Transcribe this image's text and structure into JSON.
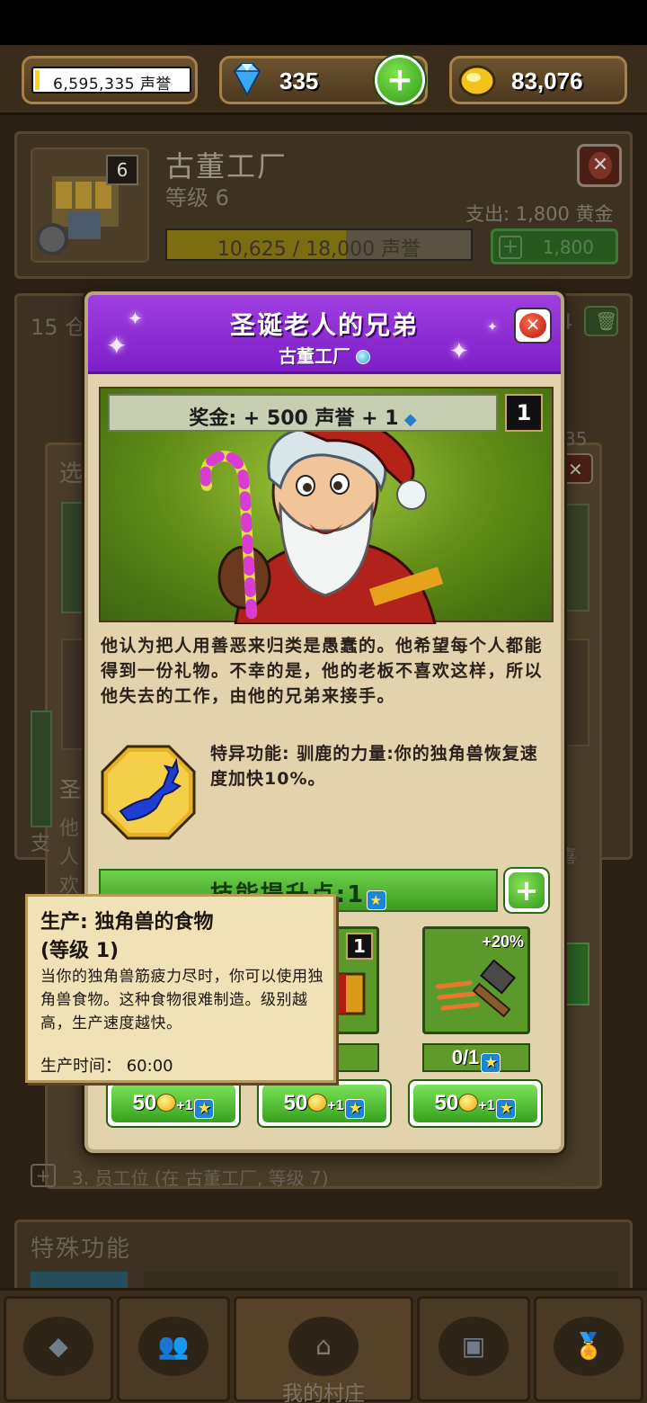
{
  "hud": {
    "reputation": "6,595,335 声誉",
    "gems": "335",
    "gold": "83,076"
  },
  "building": {
    "level_badge": "6",
    "name": "古董工厂",
    "level": "等级 6",
    "expense": "支出: 1,800 黄金",
    "progress_text": "10,625 / 18,000 声誉",
    "progress_fraction": 0.59,
    "upgrade_cost": "1,800"
  },
  "background": {
    "inventory_label": "15 仓",
    "inventory_right": "4",
    "sub_title": "选",
    "side_a": "圣",
    "side_b": "他人欢",
    "side_c": "支",
    "side_d": "喜",
    "num_35": "35",
    "worker_slot": "3. 员工位 (在 古董工厂, 等级 7)",
    "special_title": "特殊功能"
  },
  "nav": {
    "center_label": "我的村庄"
  },
  "modal": {
    "title": "圣诞老人的兄弟",
    "subtitle": "古董工厂",
    "bonus": "奖金: + 500 声誉 + 1",
    "count": "1",
    "description": "他认为把人用善恶来归类是愚蠢的。他希望每个人都能得到一份礼物。不幸的是，他的老板不喜欢这样，所以他失去的工作，由他的兄弟来接手。",
    "ability": "特异功能: 驯鹿的力量:你的独角兽恢复速度加快10%。",
    "skill_points": "技能提升点:1",
    "skills": [
      {
        "badge": "",
        "progress": ""
      },
      {
        "badge": "1",
        "progress": ""
      },
      {
        "badge": "+20%",
        "progress": "0/1"
      }
    ],
    "cost_label": "50",
    "cost_plus": "+1"
  },
  "tooltip": {
    "title": "生产: 独角兽的食物",
    "level": "(等级 1)",
    "description": "当你的独角兽筋疲力尽时，你可以使用独角兽食物。这种食物很难制造。级别越高，生产速度越快。",
    "time_label": "生产时间：  60:00"
  },
  "colors": {
    "modal_header": "#8a2fd6",
    "accent_green": "#3c9a22",
    "panel_bg": "#e3d3ad"
  }
}
